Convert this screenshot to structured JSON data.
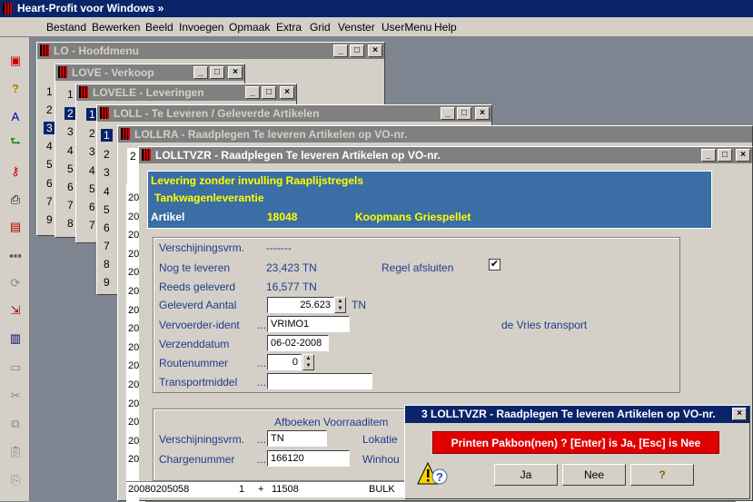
{
  "app": {
    "title": "Heart-Profit voor Windows  »"
  },
  "menu": [
    {
      "label": "Bestand"
    },
    {
      "label": "Bewerken"
    },
    {
      "label": "Beeld"
    },
    {
      "label": "Invoegen"
    },
    {
      "label": "Opmaak"
    },
    {
      "label": "Extra"
    },
    {
      "label": "Grid"
    },
    {
      "label": "Venster"
    },
    {
      "label": "UserMenu"
    },
    {
      "label": "Help"
    }
  ],
  "toolbar": [
    "calendar-icon",
    "help-icon",
    "text-style-icon",
    "green-arrow-icon",
    "key-icon",
    "printer-icon",
    "form-icon",
    "dots-icon",
    "refresh-icon",
    "export-icon",
    "report-icon",
    "window-icon",
    "scissors-icon",
    "copy-icon",
    "clipboard-icon",
    "paste-icon"
  ],
  "windows": {
    "lo": {
      "title": "LO - Hoofdmenu",
      "rows": [
        "1",
        "2",
        "3",
        "4",
        "5",
        "6",
        "7",
        "8",
        "9"
      ]
    },
    "love": {
      "title": "LOVE - Verkoop",
      "rows": [
        "1",
        "2",
        "3",
        "4",
        "5",
        "6",
        "7",
        "8"
      ]
    },
    "lovele": {
      "title": "LOVELE - Leveringen",
      "rows": [
        "1",
        "2",
        "3",
        "4",
        "5",
        "6",
        "7",
        "8"
      ]
    },
    "loll": {
      "title": "LOLL - Te Leveren / Geleverde Artikelen",
      "rows": [
        "1",
        "2",
        "3",
        "4",
        "5",
        "6",
        "7",
        "8",
        "9"
      ]
    },
    "lollra": {
      "title": "LOLLRA - Raadplegen Te leveren Artikelen op VO-nr.",
      "rows": [
        "2",
        "20",
        "20",
        "20",
        "20",
        "20",
        "20",
        "20",
        "20",
        "20",
        "20",
        "20",
        "20",
        "20",
        "20",
        "20",
        "20"
      ]
    },
    "lolltvzr": {
      "title": "LOLLTVZR - Raadplegen Te leveren Artikelen op VO-nr."
    }
  },
  "header": {
    "line1": "Levering zonder invulling Raaplijstregels",
    "line2": "Tankwagenleverantie",
    "artikel_label": "Artikel",
    "artikel_nr": "18048",
    "artikel_naam": "Koopmans Griespellet"
  },
  "form": {
    "verschijningsvrm_label": "Verschijningsvrm.",
    "verschijningsvrm_value": "-------",
    "nog_label": "Nog te leveren",
    "nog_value": "23,423 TN",
    "regel_label": "Regel afsluiten",
    "regel_checked": "✔",
    "reeds_label": "Reeds geleverd",
    "reeds_value": "16,577 TN",
    "geleverd_label": "Geleverd Aantal",
    "geleverd_value": "25.623",
    "geleverd_unit": "TN",
    "vervoerder_label": "Vervoerder-ident",
    "vervoerder_value": "VRIMO1",
    "vervoerder_name": "de Vries transport",
    "verzend_label": "Verzenddatum",
    "verzend_value": "06-02-2008",
    "route_label": "Routenummer",
    "route_value": "0",
    "transport_label": "Transportmiddel",
    "transport_value": "",
    "ellipsis": "..."
  },
  "afboeken": {
    "title": "Afboeken Voorraaditem",
    "verschijningsvrm_label": "Verschijningsvrm.",
    "verschijningsvrm_value": "TN",
    "lokatie_label": "Lokatie",
    "charge_label": "Chargenummer",
    "charge_value": "166120",
    "winhou_label": "Winhou"
  },
  "bottom_row": {
    "c1": "20080205058",
    "c2": "1",
    "c3": "+",
    "c4": "11508",
    "c5": "BULK"
  },
  "dialog": {
    "title": "3 LOLLTVZR - Raadplegen Te leveren Artikelen op VO-nr.",
    "message": "Printen Pakbon(nen) ?  [Enter] is Ja, [Esc] is Nee",
    "ja": "Ja",
    "nee": "Nee",
    "help": "?"
  }
}
